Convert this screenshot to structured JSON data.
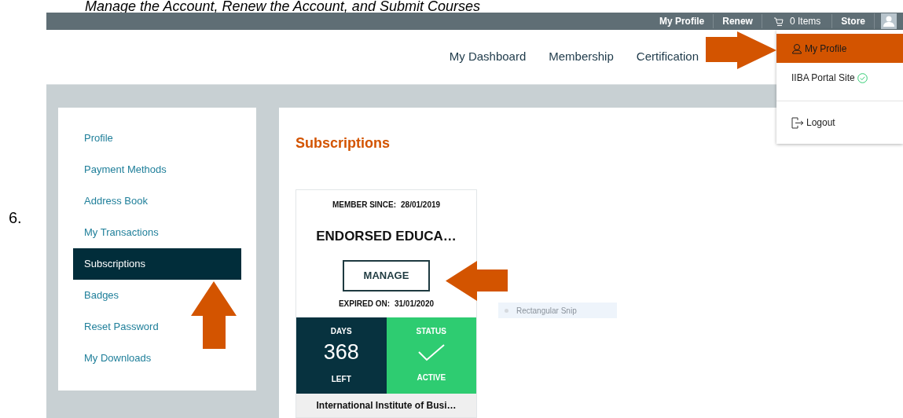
{
  "caption": "Manage the Account, Renew the Account, and Submit Courses",
  "step_number": "6.",
  "top_bar": [
    {
      "kind": "link",
      "label": "My Profile"
    },
    {
      "kind": "link",
      "label": "Renew"
    },
    {
      "kind": "cart",
      "label": "0 Items"
    },
    {
      "kind": "link",
      "label": "Store"
    },
    {
      "kind": "avatar"
    }
  ],
  "nav": [
    "My Dashboard",
    "Membership",
    "Certification"
  ],
  "dropdown": [
    {
      "kind": "profile",
      "label": "My Profile",
      "selected": true
    },
    {
      "kind": "portal",
      "label": "IIBA Portal Site",
      "selected": false
    },
    {
      "kind": "logout",
      "label": "Logout",
      "selected": false
    }
  ],
  "sidebar": [
    {
      "label": "Profile",
      "selected": false
    },
    {
      "label": "Payment Methods",
      "selected": false
    },
    {
      "label": "Address Book",
      "selected": false
    },
    {
      "label": "My Transactions",
      "selected": false
    },
    {
      "label": "Subscriptions",
      "selected": true
    },
    {
      "label": "Badges",
      "selected": false
    },
    {
      "label": "Reset Password",
      "selected": false
    },
    {
      "label": "My Downloads",
      "selected": false
    }
  ],
  "section_title": "Subscriptions",
  "subscription": {
    "member_since_label": "MEMBER SINCE:",
    "member_since": "28/01/2019",
    "name": "ENDORSED EDUCA…",
    "button": "MANAGE",
    "expired_label": "EXPIRED ON:",
    "expired": "31/01/2020",
    "days_label": "DAYS",
    "days": "368",
    "days_sub": "LEFT",
    "status_label": "STATUS",
    "status": "ACTIVE",
    "organization": "International Institute of Busi…"
  },
  "snip_tooltip": "Rectangular Snip"
}
